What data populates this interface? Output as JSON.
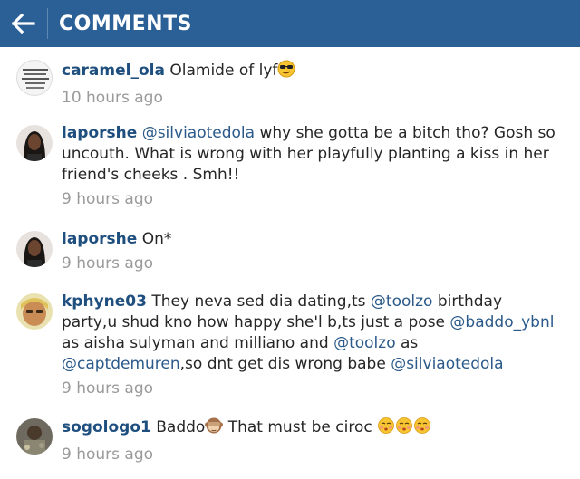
{
  "header": {
    "title": "COMMENTS",
    "back_icon": "arrow-left-icon",
    "background": "#2b6096"
  },
  "comments": [
    {
      "username": "caramel_ola",
      "text": " Olamide of lyf",
      "emoji": "sunglasses-face-emoji",
      "time": "10 hours ago"
    },
    {
      "username": "laporshe",
      "mention": "@silviaotedola",
      "text": " why she gotta be a bitch tho? Gosh so uncouth. What is wrong with her playfully planting a kiss in her friend's cheeks . Smh!!",
      "time": "9 hours ago"
    },
    {
      "username": "laporshe",
      "text": " On*",
      "time": "9 hours ago"
    },
    {
      "username": "kphyne03",
      "text_1": " They neva sed dia dating,ts  ",
      "mention_1": "@toolzo",
      "text_2": " birthday party,u shud kno how happy she'l b,ts just a pose ",
      "mention_2": "@baddo_ybnl",
      "text_3": "  as aisha sulyman and milliano and ",
      "mention_3": "@toolzo",
      "text_4": " as ",
      "mention_4": "@captdemuren",
      "text_5": ",so dnt get dis wrong babe ",
      "mention_5": "@silviaotedola",
      "time": "9 hours ago"
    },
    {
      "username": "sogologo1",
      "text_1": " Baddo",
      "emoji_1": "see-no-evil-monkey-emoji",
      "text_2": " That must be ciroc ",
      "emoji_2": "kissing-face-emoji",
      "time": "9 hours ago"
    }
  ],
  "colors": {
    "username": "#1f4f7e",
    "mention": "#2b5a8a",
    "time": "#9a9a9a"
  }
}
